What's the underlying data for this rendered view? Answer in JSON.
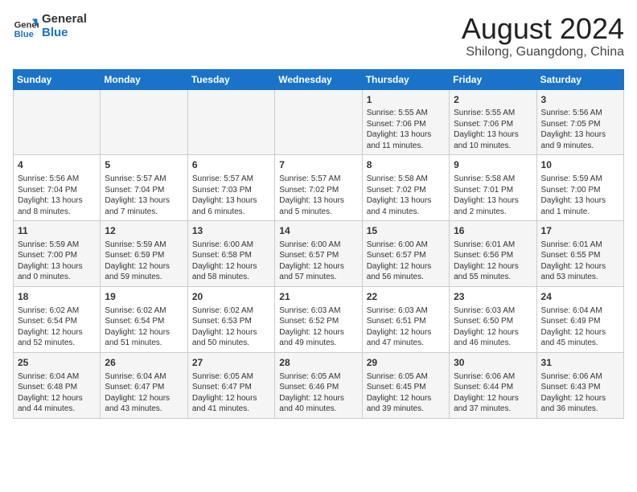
{
  "header": {
    "logo_line1": "General",
    "logo_line2": "Blue",
    "month_year": "August 2024",
    "location": "Shilong, Guangdong, China"
  },
  "weekdays": [
    "Sunday",
    "Monday",
    "Tuesday",
    "Wednesday",
    "Thursday",
    "Friday",
    "Saturday"
  ],
  "weeks": [
    [
      {
        "day": "",
        "info": ""
      },
      {
        "day": "",
        "info": ""
      },
      {
        "day": "",
        "info": ""
      },
      {
        "day": "",
        "info": ""
      },
      {
        "day": "1",
        "info": "Sunrise: 5:55 AM\nSunset: 7:06 PM\nDaylight: 13 hours\nand 11 minutes."
      },
      {
        "day": "2",
        "info": "Sunrise: 5:55 AM\nSunset: 7:06 PM\nDaylight: 13 hours\nand 10 minutes."
      },
      {
        "day": "3",
        "info": "Sunrise: 5:56 AM\nSunset: 7:05 PM\nDaylight: 13 hours\nand 9 minutes."
      }
    ],
    [
      {
        "day": "4",
        "info": "Sunrise: 5:56 AM\nSunset: 7:04 PM\nDaylight: 13 hours\nand 8 minutes."
      },
      {
        "day": "5",
        "info": "Sunrise: 5:57 AM\nSunset: 7:04 PM\nDaylight: 13 hours\nand 7 minutes."
      },
      {
        "day": "6",
        "info": "Sunrise: 5:57 AM\nSunset: 7:03 PM\nDaylight: 13 hours\nand 6 minutes."
      },
      {
        "day": "7",
        "info": "Sunrise: 5:57 AM\nSunset: 7:02 PM\nDaylight: 13 hours\nand 5 minutes."
      },
      {
        "day": "8",
        "info": "Sunrise: 5:58 AM\nSunset: 7:02 PM\nDaylight: 13 hours\nand 4 minutes."
      },
      {
        "day": "9",
        "info": "Sunrise: 5:58 AM\nSunset: 7:01 PM\nDaylight: 13 hours\nand 2 minutes."
      },
      {
        "day": "10",
        "info": "Sunrise: 5:59 AM\nSunset: 7:00 PM\nDaylight: 13 hours\nand 1 minute."
      }
    ],
    [
      {
        "day": "11",
        "info": "Sunrise: 5:59 AM\nSunset: 7:00 PM\nDaylight: 13 hours\nand 0 minutes."
      },
      {
        "day": "12",
        "info": "Sunrise: 5:59 AM\nSunset: 6:59 PM\nDaylight: 12 hours\nand 59 minutes."
      },
      {
        "day": "13",
        "info": "Sunrise: 6:00 AM\nSunset: 6:58 PM\nDaylight: 12 hours\nand 58 minutes."
      },
      {
        "day": "14",
        "info": "Sunrise: 6:00 AM\nSunset: 6:57 PM\nDaylight: 12 hours\nand 57 minutes."
      },
      {
        "day": "15",
        "info": "Sunrise: 6:00 AM\nSunset: 6:57 PM\nDaylight: 12 hours\nand 56 minutes."
      },
      {
        "day": "16",
        "info": "Sunrise: 6:01 AM\nSunset: 6:56 PM\nDaylight: 12 hours\nand 55 minutes."
      },
      {
        "day": "17",
        "info": "Sunrise: 6:01 AM\nSunset: 6:55 PM\nDaylight: 12 hours\nand 53 minutes."
      }
    ],
    [
      {
        "day": "18",
        "info": "Sunrise: 6:02 AM\nSunset: 6:54 PM\nDaylight: 12 hours\nand 52 minutes."
      },
      {
        "day": "19",
        "info": "Sunrise: 6:02 AM\nSunset: 6:54 PM\nDaylight: 12 hours\nand 51 minutes."
      },
      {
        "day": "20",
        "info": "Sunrise: 6:02 AM\nSunset: 6:53 PM\nDaylight: 12 hours\nand 50 minutes."
      },
      {
        "day": "21",
        "info": "Sunrise: 6:03 AM\nSunset: 6:52 PM\nDaylight: 12 hours\nand 49 minutes."
      },
      {
        "day": "22",
        "info": "Sunrise: 6:03 AM\nSunset: 6:51 PM\nDaylight: 12 hours\nand 47 minutes."
      },
      {
        "day": "23",
        "info": "Sunrise: 6:03 AM\nSunset: 6:50 PM\nDaylight: 12 hours\nand 46 minutes."
      },
      {
        "day": "24",
        "info": "Sunrise: 6:04 AM\nSunset: 6:49 PM\nDaylight: 12 hours\nand 45 minutes."
      }
    ],
    [
      {
        "day": "25",
        "info": "Sunrise: 6:04 AM\nSunset: 6:48 PM\nDaylight: 12 hours\nand 44 minutes."
      },
      {
        "day": "26",
        "info": "Sunrise: 6:04 AM\nSunset: 6:47 PM\nDaylight: 12 hours\nand 43 minutes."
      },
      {
        "day": "27",
        "info": "Sunrise: 6:05 AM\nSunset: 6:47 PM\nDaylight: 12 hours\nand 41 minutes."
      },
      {
        "day": "28",
        "info": "Sunrise: 6:05 AM\nSunset: 6:46 PM\nDaylight: 12 hours\nand 40 minutes."
      },
      {
        "day": "29",
        "info": "Sunrise: 6:05 AM\nSunset: 6:45 PM\nDaylight: 12 hours\nand 39 minutes."
      },
      {
        "day": "30",
        "info": "Sunrise: 6:06 AM\nSunset: 6:44 PM\nDaylight: 12 hours\nand 37 minutes."
      },
      {
        "day": "31",
        "info": "Sunrise: 6:06 AM\nSunset: 6:43 PM\nDaylight: 12 hours\nand 36 minutes."
      }
    ]
  ]
}
